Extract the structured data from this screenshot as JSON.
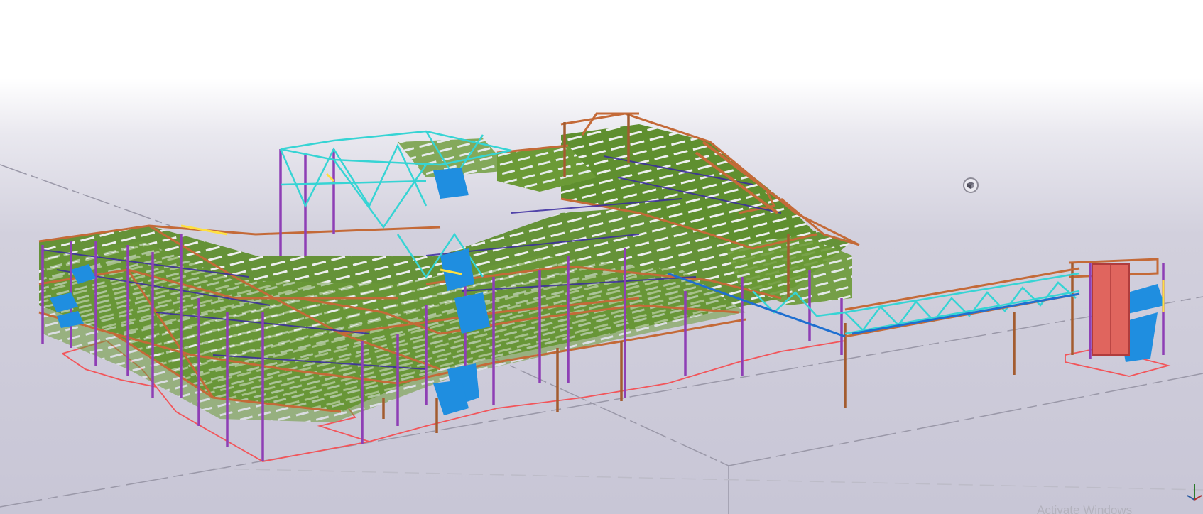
{
  "viewport": {
    "view_name": "3D model view",
    "background_top": "#ffffff",
    "background_bottom": "#c8c6d6"
  },
  "model": {
    "member_colors": {
      "floor_deck": "#5f8f2f",
      "deck_stripe": "#eef0f0",
      "beams": "#c46a38",
      "columns": "#8e3fb5",
      "bracing": "#36d4d4",
      "stairs": "#1f8ee0",
      "secondary_steel": "#3a2aa0",
      "slab_outline": "#f2555a",
      "elevator_shaft": "#e0655e",
      "railing": "#ffe040",
      "grid_line": "#8f8f9a"
    }
  },
  "toolbar": {
    "view_cube_icon": "cube-icon"
  },
  "watermark": {
    "text": "Activate Windows"
  },
  "axis_triad": {
    "icon": "xyz-axis-icon"
  }
}
